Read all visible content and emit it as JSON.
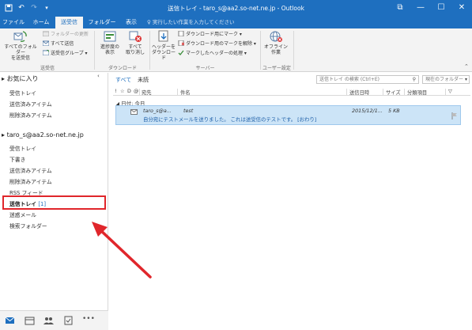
{
  "window": {
    "title": "送信トレイ - taro_s@aa2.so-net.ne.jp - Outlook",
    "controls": [
      "⧉",
      "—",
      "☐",
      "✕"
    ]
  },
  "tabs": [
    {
      "label": "ファイル",
      "active": false
    },
    {
      "label": "ホーム",
      "active": false
    },
    {
      "label": "送受信",
      "active": true
    },
    {
      "label": "フォルダー",
      "active": false
    },
    {
      "label": "表示",
      "active": false
    }
  ],
  "tell_me": "実行したい作業を入力してください",
  "ribbon": {
    "send_receive_all_line1": "すべてのフォルダー",
    "send_receive_all_line2": "を送受信",
    "update_folder": "フォルダーの更新",
    "send_all": "すべて送信",
    "send_receive_groups": "送受信グループ",
    "group_send_receive": "送受信",
    "show_progress_line1": "進捗度の",
    "show_progress_line2": "表示",
    "cancel_all_line1": "すべて",
    "cancel_all_line2": "取り消し",
    "group_download": "ダウンロード",
    "download_headers_line1": "ヘッダーを",
    "download_headers_line2": "ダウンロード",
    "mark_to_download": "ダウンロード用にマーク",
    "unmark_to_download": "ダウンロード用のマークを解除",
    "process_marked": "マークしたヘッダーの処理",
    "group_server": "サーバー",
    "work_offline_line1": "オフライン",
    "work_offline_line2": "作業",
    "group_preferences": "ユーザー設定"
  },
  "favorites": {
    "header": "お気に入り",
    "items": [
      "受信トレイ",
      "送信済みアイテム",
      "削除済みアイテム"
    ]
  },
  "account": {
    "header": "taro_s@aa2.so-net.ne.jp",
    "items": [
      "受信トレイ",
      "下書き",
      "送信済みアイテム",
      "削除済みアイテム",
      "RSS フィード"
    ],
    "selected_label": "送信トレイ",
    "selected_count": "[1]",
    "after_items": [
      "迷惑メール",
      "検索フォルダー"
    ]
  },
  "filters": {
    "all": "すべて",
    "unread": "未読"
  },
  "search": {
    "placeholder": "送信トレイ の検索 (Ctrl+E)",
    "scope": "現在のフォルダー"
  },
  "columns": [
    "!",
    "☆",
    "D",
    "@",
    "宛先",
    "件名",
    "送信日時",
    "サイズ",
    "分類項目",
    "▽"
  ],
  "date_group": "日付: 今日",
  "message": {
    "to": "taro_s@a...",
    "subject": "test",
    "date": "2015/12/1...",
    "size": "5 KB",
    "preview": "自分宛にテストメールを送りました。 これは送受信のテストです。 [おわり]"
  },
  "colors": {
    "accent": "#1e6fbf",
    "selection": "#cce4f7",
    "annotation": "#e0262b"
  }
}
